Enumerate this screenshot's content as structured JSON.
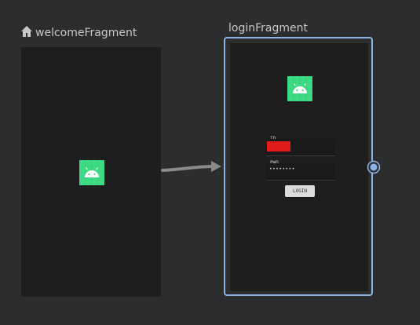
{
  "destinations": {
    "welcome": {
      "name": "welcomeFragment",
      "is_start": true,
      "icons": {
        "start": "home-icon",
        "preview": "android-icon"
      }
    },
    "login": {
      "name": "loginFragment",
      "selected": true,
      "preview": {
        "logo_icon": "android-icon",
        "id_label": "ID",
        "pwd_label": "PWD",
        "pwd_value": "••••••••",
        "button_label": "LOGIN"
      }
    }
  },
  "actions": [
    {
      "from": "welcomeFragment",
      "to": "loginFragment",
      "icon": "arrow-right-icon"
    }
  ],
  "colors": {
    "selection": "#8ab4e8",
    "android_green": "#3ddc84",
    "id_highlight": "#e21c1c",
    "canvas": "#2c2d2f",
    "frame": "#1e1e1e"
  }
}
